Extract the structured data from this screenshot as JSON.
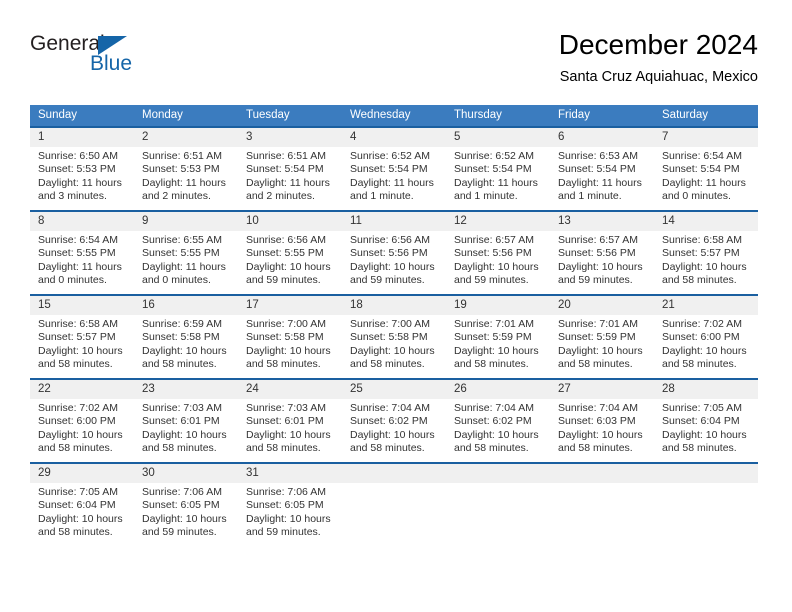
{
  "brand": {
    "name_top": "General",
    "name_bottom": "Blue",
    "accent_color": "#1565a8",
    "text_color": "#231f20"
  },
  "header": {
    "title": "December 2024",
    "subtitle": "Santa Cruz Aquiahuac, Mexico"
  },
  "theme": {
    "header_bg": "#3b7cbf",
    "row_border": "#1a5fa0",
    "daynum_bg": "#f0f0f0",
    "text": "#333333"
  },
  "calendar": {
    "weekday_headers": [
      "Sunday",
      "Monday",
      "Tuesday",
      "Wednesday",
      "Thursday",
      "Friday",
      "Saturday"
    ],
    "labels": {
      "sunrise": "Sunrise:",
      "sunset": "Sunset:",
      "daylight": "Daylight:"
    },
    "weeks": [
      [
        {
          "day": "1",
          "sunrise": "Sunrise: 6:50 AM",
          "sunset": "Sunset: 5:53 PM",
          "daylight": "Daylight: 11 hours and 3 minutes."
        },
        {
          "day": "2",
          "sunrise": "Sunrise: 6:51 AM",
          "sunset": "Sunset: 5:53 PM",
          "daylight": "Daylight: 11 hours and 2 minutes."
        },
        {
          "day": "3",
          "sunrise": "Sunrise: 6:51 AM",
          "sunset": "Sunset: 5:54 PM",
          "daylight": "Daylight: 11 hours and 2 minutes."
        },
        {
          "day": "4",
          "sunrise": "Sunrise: 6:52 AM",
          "sunset": "Sunset: 5:54 PM",
          "daylight": "Daylight: 11 hours and 1 minute."
        },
        {
          "day": "5",
          "sunrise": "Sunrise: 6:52 AM",
          "sunset": "Sunset: 5:54 PM",
          "daylight": "Daylight: 11 hours and 1 minute."
        },
        {
          "day": "6",
          "sunrise": "Sunrise: 6:53 AM",
          "sunset": "Sunset: 5:54 PM",
          "daylight": "Daylight: 11 hours and 1 minute."
        },
        {
          "day": "7",
          "sunrise": "Sunrise: 6:54 AM",
          "sunset": "Sunset: 5:54 PM",
          "daylight": "Daylight: 11 hours and 0 minutes."
        }
      ],
      [
        {
          "day": "8",
          "sunrise": "Sunrise: 6:54 AM",
          "sunset": "Sunset: 5:55 PM",
          "daylight": "Daylight: 11 hours and 0 minutes."
        },
        {
          "day": "9",
          "sunrise": "Sunrise: 6:55 AM",
          "sunset": "Sunset: 5:55 PM",
          "daylight": "Daylight: 11 hours and 0 minutes."
        },
        {
          "day": "10",
          "sunrise": "Sunrise: 6:56 AM",
          "sunset": "Sunset: 5:55 PM",
          "daylight": "Daylight: 10 hours and 59 minutes."
        },
        {
          "day": "11",
          "sunrise": "Sunrise: 6:56 AM",
          "sunset": "Sunset: 5:56 PM",
          "daylight": "Daylight: 10 hours and 59 minutes."
        },
        {
          "day": "12",
          "sunrise": "Sunrise: 6:57 AM",
          "sunset": "Sunset: 5:56 PM",
          "daylight": "Daylight: 10 hours and 59 minutes."
        },
        {
          "day": "13",
          "sunrise": "Sunrise: 6:57 AM",
          "sunset": "Sunset: 5:56 PM",
          "daylight": "Daylight: 10 hours and 59 minutes."
        },
        {
          "day": "14",
          "sunrise": "Sunrise: 6:58 AM",
          "sunset": "Sunset: 5:57 PM",
          "daylight": "Daylight: 10 hours and 58 minutes."
        }
      ],
      [
        {
          "day": "15",
          "sunrise": "Sunrise: 6:58 AM",
          "sunset": "Sunset: 5:57 PM",
          "daylight": "Daylight: 10 hours and 58 minutes."
        },
        {
          "day": "16",
          "sunrise": "Sunrise: 6:59 AM",
          "sunset": "Sunset: 5:58 PM",
          "daylight": "Daylight: 10 hours and 58 minutes."
        },
        {
          "day": "17",
          "sunrise": "Sunrise: 7:00 AM",
          "sunset": "Sunset: 5:58 PM",
          "daylight": "Daylight: 10 hours and 58 minutes."
        },
        {
          "day": "18",
          "sunrise": "Sunrise: 7:00 AM",
          "sunset": "Sunset: 5:58 PM",
          "daylight": "Daylight: 10 hours and 58 minutes."
        },
        {
          "day": "19",
          "sunrise": "Sunrise: 7:01 AM",
          "sunset": "Sunset: 5:59 PM",
          "daylight": "Daylight: 10 hours and 58 minutes."
        },
        {
          "day": "20",
          "sunrise": "Sunrise: 7:01 AM",
          "sunset": "Sunset: 5:59 PM",
          "daylight": "Daylight: 10 hours and 58 minutes."
        },
        {
          "day": "21",
          "sunrise": "Sunrise: 7:02 AM",
          "sunset": "Sunset: 6:00 PM",
          "daylight": "Daylight: 10 hours and 58 minutes."
        }
      ],
      [
        {
          "day": "22",
          "sunrise": "Sunrise: 7:02 AM",
          "sunset": "Sunset: 6:00 PM",
          "daylight": "Daylight: 10 hours and 58 minutes."
        },
        {
          "day": "23",
          "sunrise": "Sunrise: 7:03 AM",
          "sunset": "Sunset: 6:01 PM",
          "daylight": "Daylight: 10 hours and 58 minutes."
        },
        {
          "day": "24",
          "sunrise": "Sunrise: 7:03 AM",
          "sunset": "Sunset: 6:01 PM",
          "daylight": "Daylight: 10 hours and 58 minutes."
        },
        {
          "day": "25",
          "sunrise": "Sunrise: 7:04 AM",
          "sunset": "Sunset: 6:02 PM",
          "daylight": "Daylight: 10 hours and 58 minutes."
        },
        {
          "day": "26",
          "sunrise": "Sunrise: 7:04 AM",
          "sunset": "Sunset: 6:02 PM",
          "daylight": "Daylight: 10 hours and 58 minutes."
        },
        {
          "day": "27",
          "sunrise": "Sunrise: 7:04 AM",
          "sunset": "Sunset: 6:03 PM",
          "daylight": "Daylight: 10 hours and 58 minutes."
        },
        {
          "day": "28",
          "sunrise": "Sunrise: 7:05 AM",
          "sunset": "Sunset: 6:04 PM",
          "daylight": "Daylight: 10 hours and 58 minutes."
        }
      ],
      [
        {
          "day": "29",
          "sunrise": "Sunrise: 7:05 AM",
          "sunset": "Sunset: 6:04 PM",
          "daylight": "Daylight: 10 hours and 58 minutes."
        },
        {
          "day": "30",
          "sunrise": "Sunrise: 7:06 AM",
          "sunset": "Sunset: 6:05 PM",
          "daylight": "Daylight: 10 hours and 59 minutes."
        },
        {
          "day": "31",
          "sunrise": "Sunrise: 7:06 AM",
          "sunset": "Sunset: 6:05 PM",
          "daylight": "Daylight: 10 hours and 59 minutes."
        },
        {
          "day": "",
          "sunrise": "",
          "sunset": "",
          "daylight": ""
        },
        {
          "day": "",
          "sunrise": "",
          "sunset": "",
          "daylight": ""
        },
        {
          "day": "",
          "sunrise": "",
          "sunset": "",
          "daylight": ""
        },
        {
          "day": "",
          "sunrise": "",
          "sunset": "",
          "daylight": ""
        }
      ]
    ]
  }
}
